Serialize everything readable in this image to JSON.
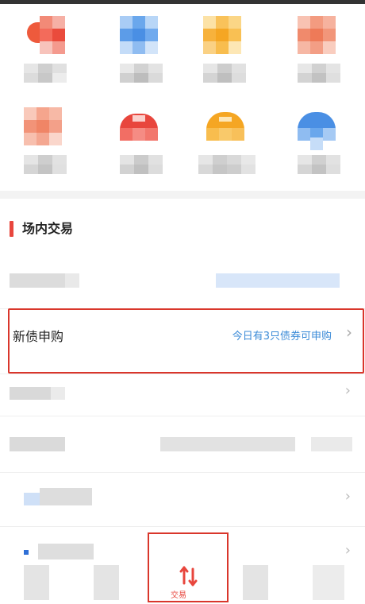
{
  "section": {
    "title": "场内交易"
  },
  "bond_row": {
    "label": "新债申购",
    "hint": "今日有3只债券可申购",
    "chevron": "›"
  },
  "bottom_nav": {
    "active_label": "交易"
  },
  "icons": {
    "section_accent": "red-bar",
    "active_tab": "up-down-arrows-icon"
  },
  "colors": {
    "accent": "#e8463d",
    "highlight_border": "#d9362b",
    "hint_text": "#3a8ad7"
  }
}
